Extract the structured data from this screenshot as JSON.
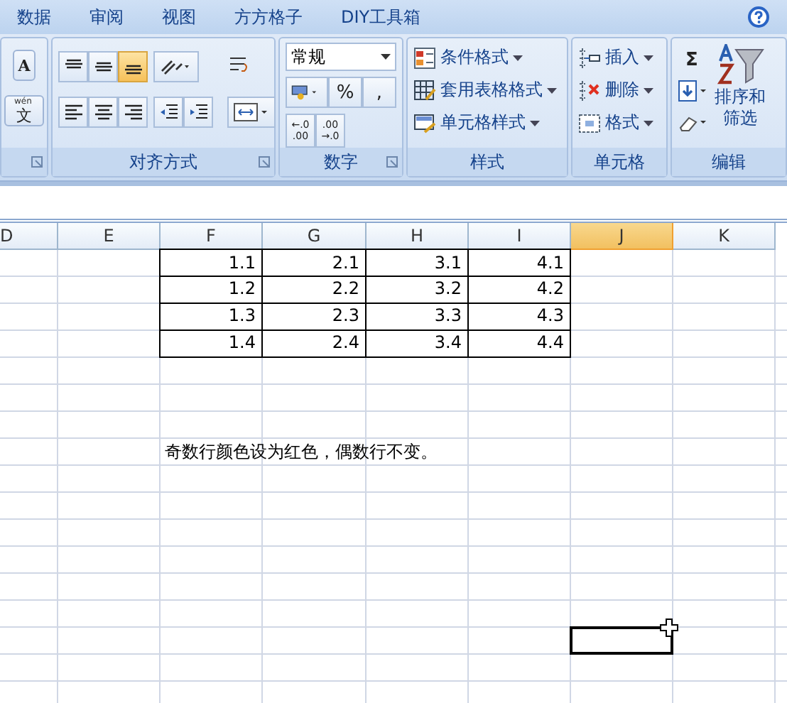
{
  "tabs": [
    {
      "label": "数据"
    },
    {
      "label": "审阅"
    },
    {
      "label": "视图"
    },
    {
      "label": "方方格子"
    },
    {
      "label": "DIY工具箱"
    }
  ],
  "ribbon": {
    "font": {
      "grow_label": "A",
      "phonetic_ruby": "wén",
      "phonetic_base": "文"
    },
    "alignment": {
      "label": "对齐方式",
      "vertical": [
        {
          "selected": false
        },
        {
          "selected": false
        },
        {
          "selected": true
        }
      ],
      "horizontal": [
        {
          "selected": false
        },
        {
          "selected": false
        },
        {
          "selected": false
        }
      ]
    },
    "number": {
      "label": "数字",
      "format": "常规",
      "percent": "%",
      "comma": ",",
      "increase": [
        "←.0",
        ".00"
      ],
      "decrease": [
        ".00",
        "→.0"
      ]
    },
    "styles": {
      "label": "样式",
      "items": [
        {
          "kind": "conditional",
          "label": "条件格式"
        },
        {
          "kind": "table",
          "label": "套用表格格式"
        },
        {
          "kind": "cell",
          "label": "单元格样式"
        }
      ]
    },
    "cells": {
      "label": "单元格",
      "items": [
        {
          "kind": "insert",
          "label": "插入"
        },
        {
          "kind": "delete",
          "label": "删除"
        },
        {
          "kind": "format",
          "label": "格式"
        }
      ]
    },
    "editing": {
      "label": "编辑",
      "sum": "Σ",
      "sort_lines": [
        "排序和",
        "筛选"
      ]
    }
  },
  "sheet": {
    "columns": [
      {
        "label": "D",
        "selected": false
      },
      {
        "label": "E",
        "selected": false
      },
      {
        "label": "F",
        "selected": false
      },
      {
        "label": "G",
        "selected": false
      },
      {
        "label": "H",
        "selected": false
      },
      {
        "label": "I",
        "selected": false
      },
      {
        "label": "J",
        "selected": true
      },
      {
        "label": "K",
        "selected": false
      }
    ],
    "rows": [
      {
        "kind": "data",
        "values": [
          "1.1",
          "2.1",
          "3.1",
          "4.1"
        ]
      },
      {
        "kind": "data",
        "values": [
          "1.2",
          "2.2",
          "3.2",
          "4.2"
        ]
      },
      {
        "kind": "data",
        "values": [
          "1.3",
          "2.3",
          "3.3",
          "4.3"
        ]
      },
      {
        "kind": "data",
        "values": [
          "1.4",
          "2.4",
          "3.4",
          "4.4"
        ]
      },
      {
        "kind": "blank"
      },
      {
        "kind": "blank"
      },
      {
        "kind": "blank"
      },
      {
        "kind": "note",
        "text": "奇数行颜色设为红色，偶数行不变。"
      },
      {
        "kind": "blank"
      },
      {
        "kind": "blank"
      },
      {
        "kind": "blank"
      },
      {
        "kind": "blank"
      },
      {
        "kind": "blank"
      },
      {
        "kind": "blank"
      },
      {
        "kind": "active"
      },
      {
        "kind": "blank"
      },
      {
        "kind": "blank"
      }
    ]
  }
}
